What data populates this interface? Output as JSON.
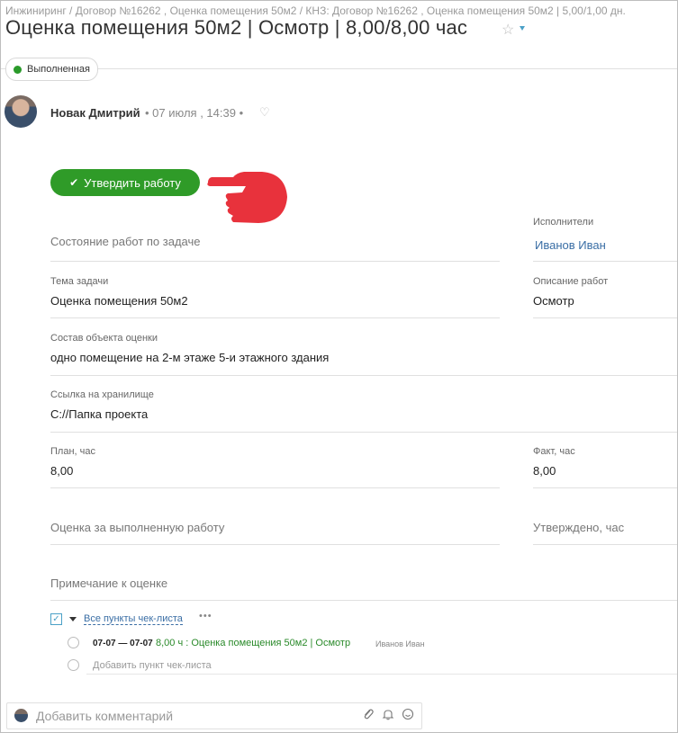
{
  "breadcrumb": "Инжиниринг / Договор №16262 , Оценка помещения 50м2 / КНЗ: Договор №16262 , Оценка помещения 50м2 | 5,00/1,00 дн.",
  "title": "Оценка помещения 50м2 | Осмотр | 8,00/8,00 час",
  "status": {
    "label": "Выполненная",
    "color": "#2a9a2a"
  },
  "post": {
    "author": "Новак Дмитрий",
    "meta": "• 07 июля , 14:39 •"
  },
  "approve_button": {
    "label": "Утвердить работу",
    "icon": "check-icon",
    "color": "#2f9b28"
  },
  "pointer": {
    "icon": "pointing-hand-icon",
    "color": "#e8323c"
  },
  "fields": {
    "work_state": {
      "label": "Состояние работ по задаче"
    },
    "executors": {
      "label": "Исполнители",
      "value": "Иванов Иван"
    },
    "topic": {
      "label": "Тема задачи",
      "value": "Оценка помещения 50м2"
    },
    "work_description": {
      "label": "Описание работ",
      "value": "Осмотр"
    },
    "object_composition": {
      "label": "Состав объекта оценки",
      "value": "одно помещение на 2-м этаже 5-и этажного здания"
    },
    "storage_link": {
      "label": "Ссылка на хранилище",
      "value": "C://Папка проекта"
    },
    "plan_hours": {
      "label": "План, час",
      "value": "8,00"
    },
    "fact_hours": {
      "label": "Факт, час",
      "value": "8,00"
    },
    "evaluation": {
      "label": "Оценка за выполненную работу"
    },
    "approved_hours": {
      "label": "Утверждено, час"
    },
    "evaluation_note": {
      "label": "Примечание к оценке"
    }
  },
  "checklist": {
    "title": "Все пункты чек-листа",
    "more": "•••",
    "items": [
      {
        "dates": "07-07 — 07-07",
        "text": "8,00 ч : Оценка помещения 50м2 | Осмотр",
        "user": "Иванов Иван"
      }
    ],
    "add_placeholder": "Добавить пункт чек-листа"
  },
  "comment": {
    "placeholder": "Добавить комментарий",
    "icons": [
      "paperclip-icon",
      "bell-icon",
      "emoji-icon"
    ]
  }
}
